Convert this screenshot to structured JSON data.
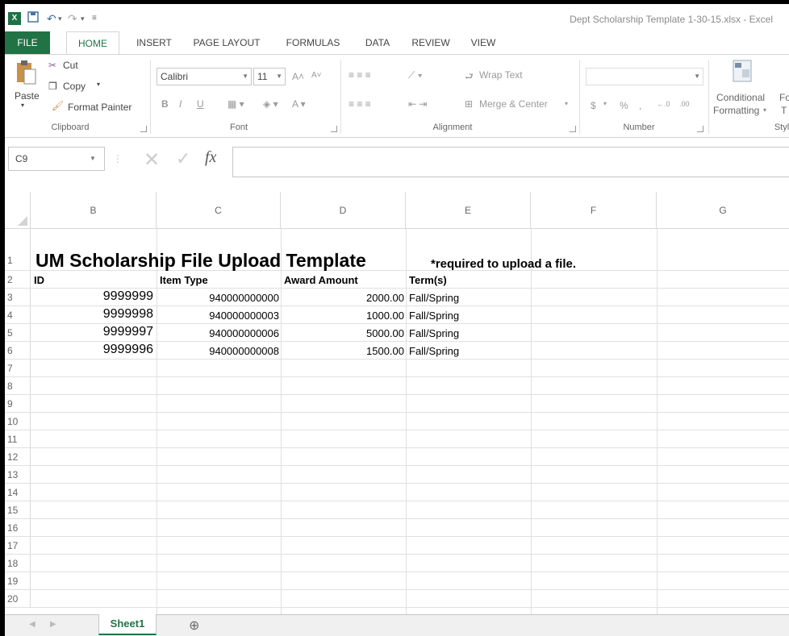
{
  "titlebar": {
    "logo": "X",
    "save_icon": "save-icon",
    "undo": "↶",
    "redo": "↷",
    "title": "Dept Scholarship Template 1-30-15.xlsx - Excel"
  },
  "tabs": [
    "FILE",
    "HOME",
    "INSERT",
    "PAGE LAYOUT",
    "FORMULAS",
    "DATA",
    "REVIEW",
    "VIEW"
  ],
  "ribbon": {
    "clipboard": {
      "paste": "Paste",
      "cut": "Cut",
      "copy": "Copy",
      "format_painter": "Format Painter",
      "label": "Clipboard"
    },
    "font": {
      "name": "Calibri",
      "size": "11",
      "bold": "B",
      "italic": "I",
      "underline": "U",
      "label": "Font"
    },
    "alignment": {
      "wrap_text": "Wrap Text",
      "merge_center": "Merge & Center",
      "label": "Alignment"
    },
    "number": {
      "format": "",
      "currency": "$",
      "percent": "%",
      "comma": ",",
      "label": "Number"
    },
    "styles": {
      "conditional": "Conditional",
      "formatting": "Formatting",
      "fo": "Fo",
      "t": "T",
      "label": "Styl"
    }
  },
  "formula_bar": {
    "name_box": "C9",
    "fx": "fx",
    "value": ""
  },
  "grid": {
    "columns": [
      "B",
      "C",
      "D",
      "E",
      "F",
      "G"
    ],
    "rows": [
      "1",
      "2",
      "3",
      "4",
      "5",
      "6",
      "7",
      "8",
      "9",
      "10",
      "11",
      "12",
      "13",
      "14",
      "15",
      "16",
      "17",
      "18",
      "19",
      "20"
    ],
    "title": "UM Scholarship File Upload Template",
    "note": "*required to upload a file.",
    "headers": [
      "ID",
      "Item Type",
      "Award Amount",
      "Term(s)"
    ],
    "data": [
      [
        "9999999",
        "940000000000",
        "2000.00",
        "Fall/Spring"
      ],
      [
        "9999998",
        "940000000003",
        "1000.00",
        "Fall/Spring"
      ],
      [
        "9999997",
        "940000000006",
        "5000.00",
        "Fall/Spring"
      ],
      [
        "9999996",
        "940000000008",
        "1500.00",
        "Fall/Spring"
      ]
    ]
  },
  "sheets": {
    "active": "Sheet1",
    "add": "⊕"
  },
  "colors": {
    "excel_green": "#217346"
  }
}
